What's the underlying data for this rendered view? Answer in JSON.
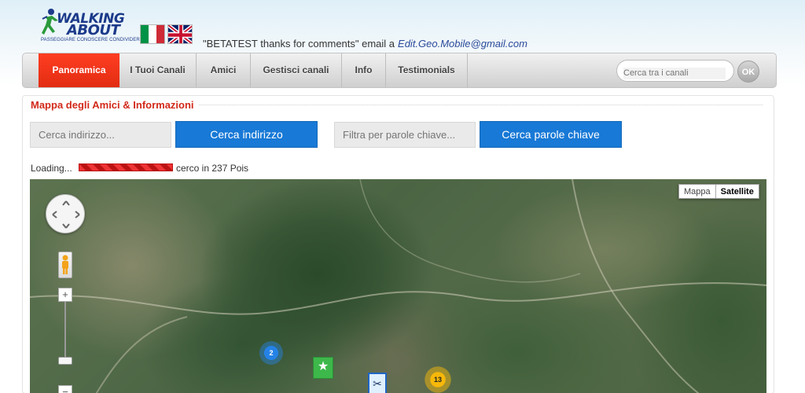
{
  "header": {
    "logo": {
      "line1": "WALKING",
      "line2": "ABOUT",
      "tagline": "PASSEGGIARE CONOSCERE CONDIVIDERE"
    },
    "flags": [
      "flag-italy-icon",
      "flag-uk-icon"
    ],
    "beta_text": "\"BETATEST thanks for comments\" email a",
    "beta_email": "Edit.Geo.Mobile@gmail.com"
  },
  "nav": {
    "items": [
      {
        "label": "Panoramica",
        "active": true
      },
      {
        "label": "I Tuoi Canali",
        "active": false
      },
      {
        "label": "Amici",
        "active": false
      },
      {
        "label": "Gestisci canali",
        "active": false
      },
      {
        "label": "Info",
        "active": false
      },
      {
        "label": "Testimonials",
        "active": false
      }
    ],
    "search_placeholder": "Cerca tra i canali",
    "ok_label": "OK"
  },
  "panel": {
    "title": "Mappa degli Amici & Informazioni",
    "address_placeholder": "Cerca indirizzo...",
    "address_button": "Cerca indirizzo",
    "keyword_placeholder": "Filtra per parole chiave...",
    "keyword_button": "Cerca parole chiave",
    "loading_label": "Loading...",
    "loading_status": "cerco in 237 Pois"
  },
  "map": {
    "type_buttons": [
      {
        "label": "Mappa",
        "active": false
      },
      {
        "label": "Satellite",
        "active": true
      }
    ],
    "zoom_in_label": "+",
    "zoom_out_label": "−",
    "clusters": [
      {
        "count": "2",
        "color": "#2582e6"
      },
      {
        "count": "13",
        "color": "#f7b80a"
      }
    ],
    "markers": [
      "star-marker-icon",
      "scissors-marker-icon"
    ]
  },
  "colors": {
    "accent_red": "#e22d12",
    "button_blue": "#1879d6",
    "title_red": "#d22a1a",
    "logo_blue": "#1c3a8a"
  }
}
